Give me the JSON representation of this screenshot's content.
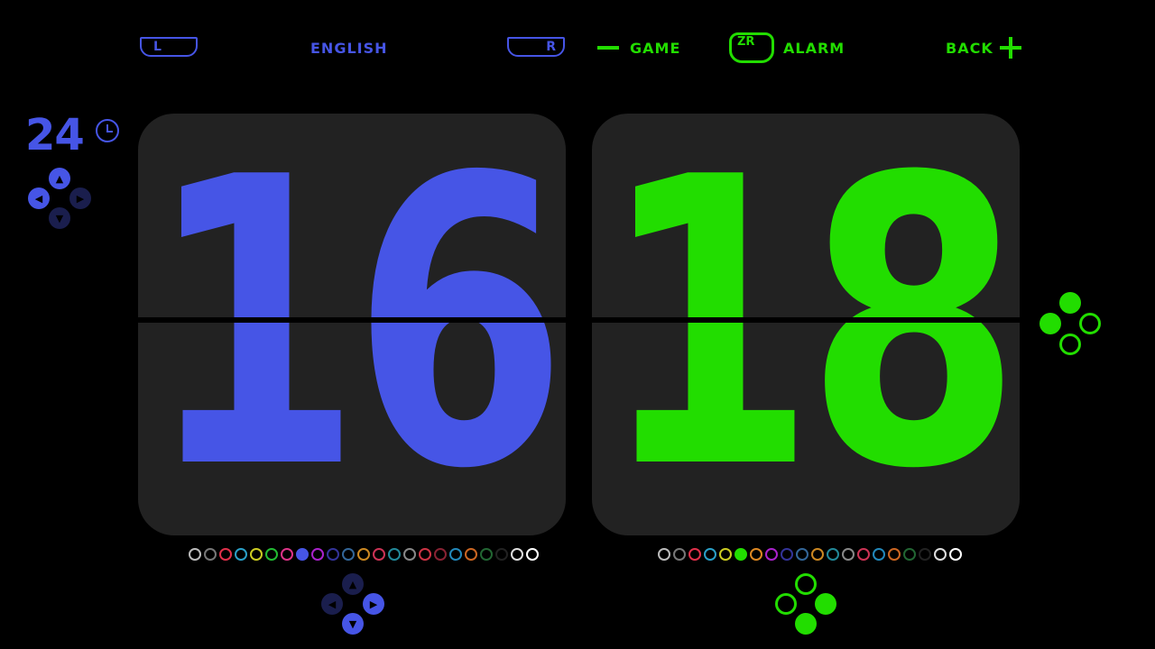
{
  "topbar": {
    "left_shoulder": "L",
    "language": "ENGLISH",
    "right_shoulder": "R",
    "game_label": "GAME",
    "zr_label": "ZR",
    "alarm_label": "ALARM",
    "back_label": "BACK"
  },
  "format": {
    "value": "24"
  },
  "clock": {
    "hours": "16",
    "minutes": "18"
  },
  "colors": {
    "blue": "#4655e6",
    "green": "#22dd00",
    "card": "#222222"
  },
  "hour_palette": {
    "colors": [
      "#bbbbbb",
      "#777777",
      "#e0304a",
      "#2aa0c8",
      "#cccc22",
      "#22bb33",
      "#dd3388",
      "#4655e6",
      "#aa22cc",
      "#333399",
      "#336699",
      "#cc8822",
      "#cc3355",
      "#228899",
      "#888888",
      "#cc3344",
      "#882233",
      "#2288bb",
      "#cc6622",
      "#226633",
      "#222222",
      "#dddddd",
      "#ffffff"
    ],
    "selected_index": 7
  },
  "minute_palette": {
    "colors": [
      "#bbbbbb",
      "#777777",
      "#e0304a",
      "#2aa0c8",
      "#cccc22",
      "#22dd00",
      "#dd8822",
      "#aa22cc",
      "#333399",
      "#336699",
      "#cc8822",
      "#228899",
      "#888888",
      "#cc3355",
      "#2288bb",
      "#cc6622",
      "#226633",
      "#222222",
      "#dddddd",
      "#ffffff"
    ],
    "selected_index": 5
  }
}
